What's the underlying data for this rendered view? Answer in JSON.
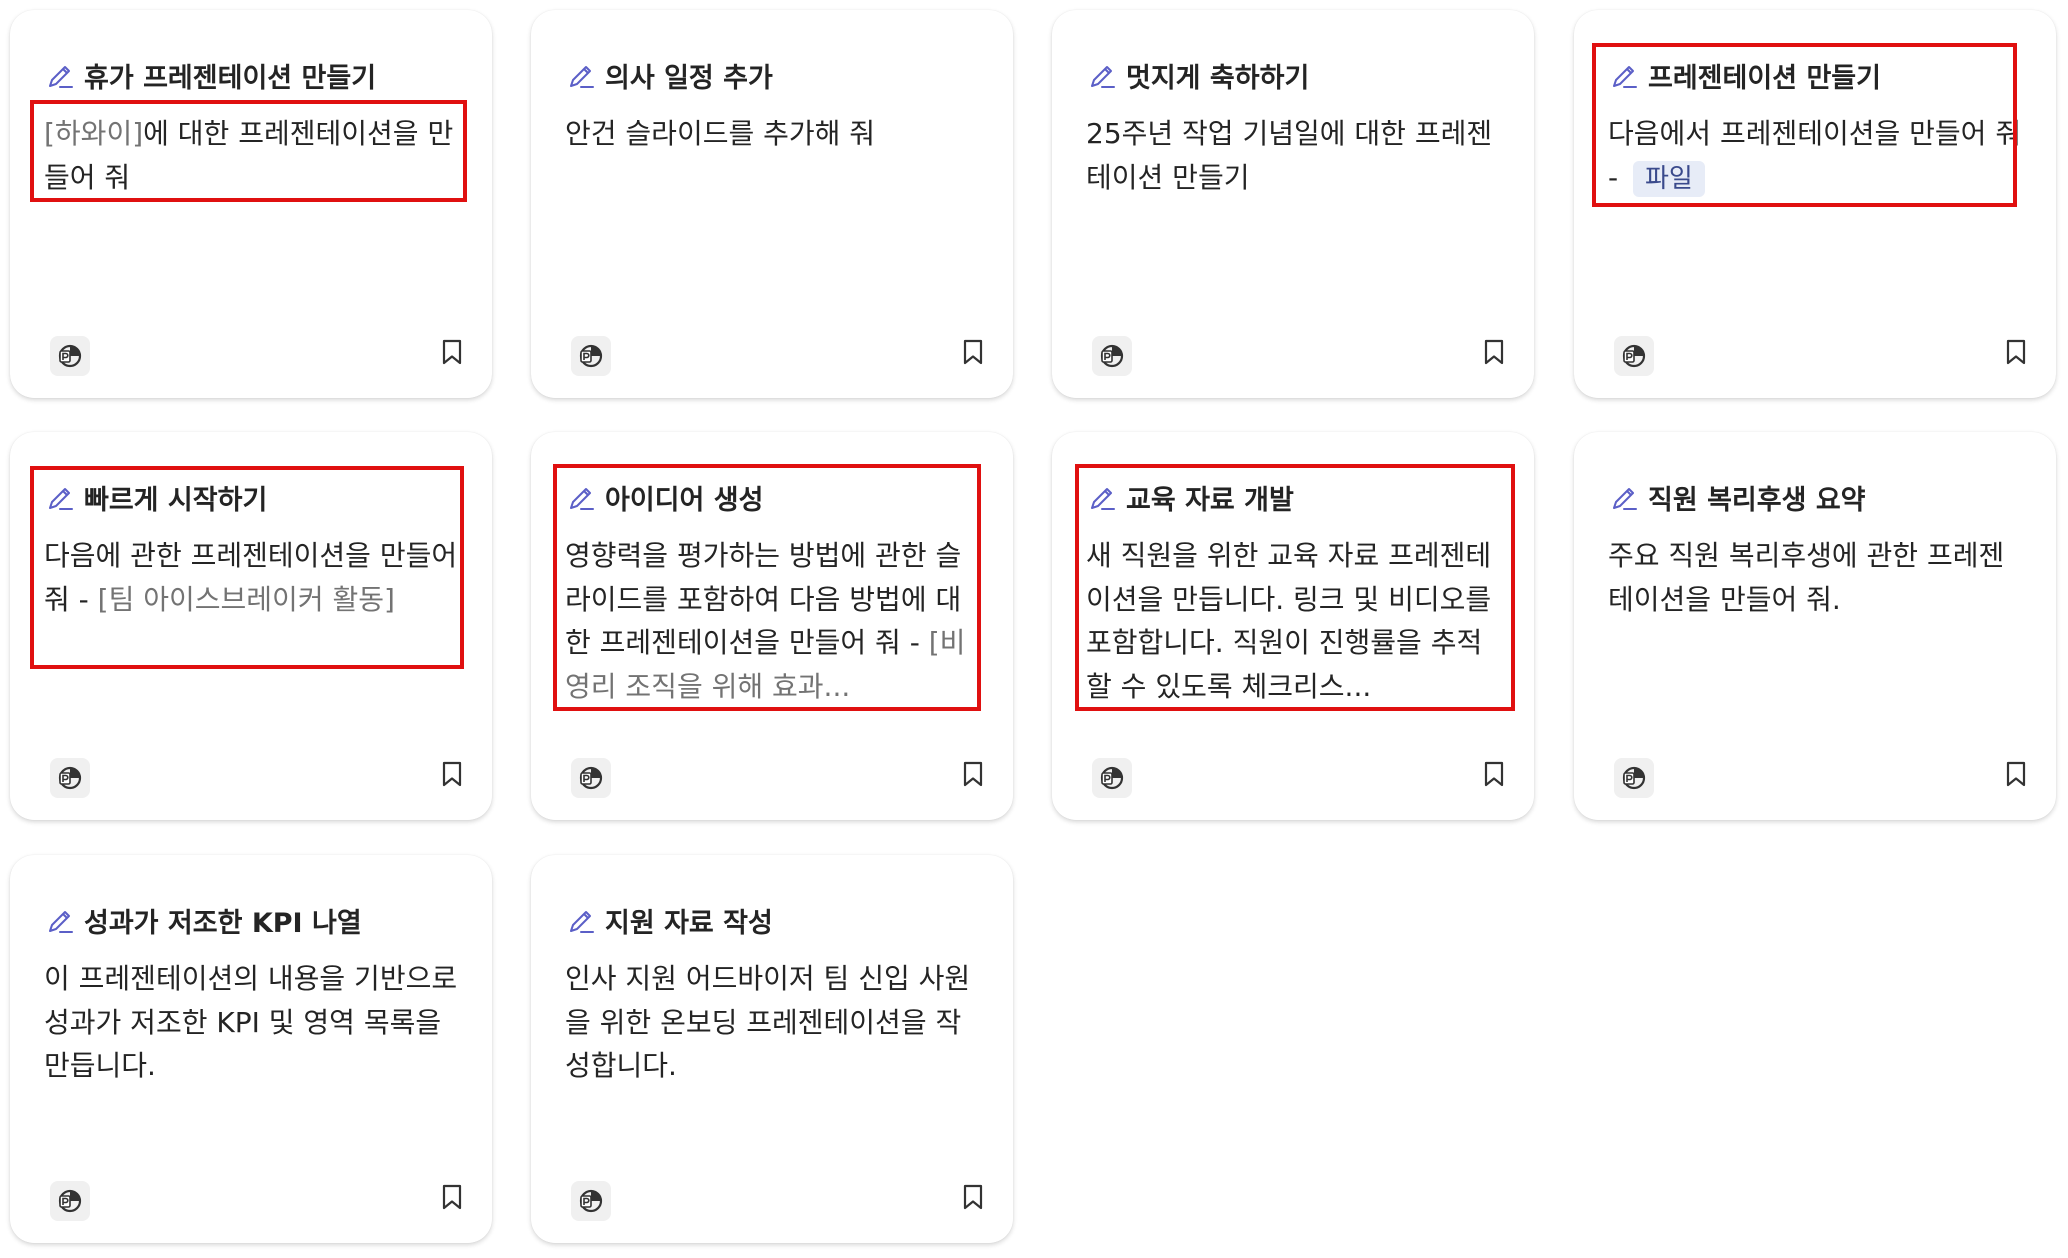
{
  "cards": [
    {
      "title": "휴가 프레젠테이션 만들기",
      "ph_before": "[하와이]",
      "text": "에 대한 프레젠테이션을 만들어 줘",
      "sep": "",
      "ph_after": "",
      "chip": ""
    },
    {
      "title": "의사 일정 추가",
      "ph_before": "",
      "text": "안건 슬라이드를 추가해 줘",
      "sep": "",
      "ph_after": "",
      "chip": ""
    },
    {
      "title": "멋지게 축하하기",
      "ph_before": "",
      "text": "25주년 작업 기념일에 대한 프레젠테이션 만들기",
      "sep": "",
      "ph_after": "",
      "chip": ""
    },
    {
      "title": "프레젠테이션 만들기",
      "ph_before": "",
      "text": "다음에서 프레젠테이션을 만들어 줘",
      "sep": " - ",
      "ph_after": "",
      "chip": "파일"
    },
    {
      "title": "빠르게 시작하기",
      "ph_before": "",
      "text": "다음에 관한 프레젠테이션을 만들어 줘",
      "sep": " - ",
      "ph_after": "[팀 아이스브레이커 활동]",
      "chip": ""
    },
    {
      "title": "아이디어 생성",
      "ph_before": "",
      "text": "영향력을 평가하는 방법에 관한 슬라이드를 포함하여 다음 방법에 대한 프레젠테이션을 만들어 줘",
      "sep": " - ",
      "ph_after": "[비영리 조직을 위해 효과...",
      "chip": ""
    },
    {
      "title": "교육 자료 개발",
      "ph_before": "",
      "text": "새 직원을 위한 교육 자료 프레젠테이션을 만듭니다. 링크 및 비디오를 포함합니다. 직원이 진행률을 추적할 수 있도록 체크리스...",
      "sep": "",
      "ph_after": "",
      "chip": ""
    },
    {
      "title": "직원 복리후생 요약",
      "ph_before": "",
      "text": "주요 직원 복리후생에 관한 프레젠테이션을 만들어 줘.",
      "sep": "",
      "ph_after": "",
      "chip": ""
    },
    {
      "title": "성과가 저조한 KPI 나열",
      "ph_before": "",
      "text": "이 프레젠테이션의 내용을 기반으로 성과가 저조한 KPI 및 영역 목록을 만듭니다.",
      "sep": "",
      "ph_after": "",
      "chip": ""
    },
    {
      "title": "지원 자료 작성",
      "ph_before": "",
      "text": "인사 지원 어드바이저 팀 신입 사원을 위한 온보딩 프레젠테이션을 작성합니다.",
      "sep": "",
      "ph_after": "",
      "chip": ""
    }
  ],
  "icons": {
    "title_icon": "pen-sparkle-icon",
    "app_icon": "powerpoint-icon",
    "save_icon": "bookmark-icon"
  },
  "colors": {
    "highlight": "#e01010",
    "pen_accent": "#5b5fc7",
    "placeholder": "#737373",
    "chip_bg": "#e7ecf7"
  }
}
